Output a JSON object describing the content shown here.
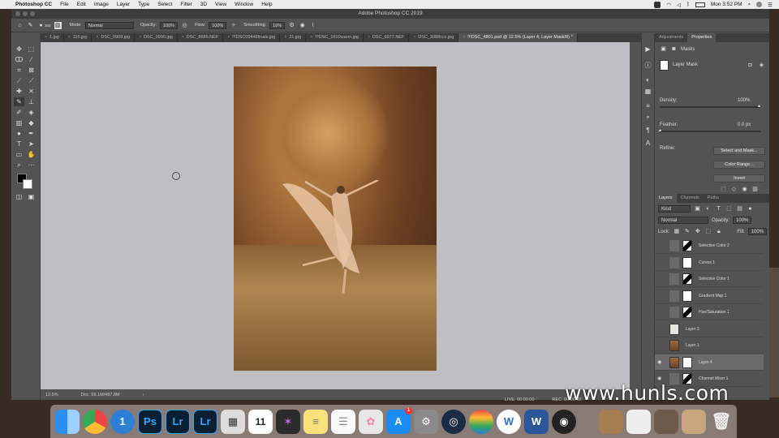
{
  "menubar": {
    "app_name": "Photoshop CC",
    "items": [
      "File",
      "Edit",
      "Image",
      "Layer",
      "Type",
      "Select",
      "Filter",
      "3D",
      "View",
      "Window",
      "Help"
    ],
    "clock": "Mon 3:52 PM"
  },
  "window": {
    "title": "Adobe Photoshop CC 2019"
  },
  "options": {
    "brush_size": "350",
    "mode_label": "Mode:",
    "mode_value": "Normal",
    "opacity_label": "Opacity:",
    "opacity_value": "100%",
    "flow_label": "Flow:",
    "flow_value": "100%",
    "smoothing_label": "Smoothing:",
    "smoothing_value": "10%"
  },
  "tabs": [
    {
      "label": "1.jpg",
      "active": false
    },
    {
      "label": "116.jpg",
      "active": false
    },
    {
      "label": "DSC_0909.jpg",
      "active": false
    },
    {
      "label": "DSC_0990.jpg",
      "active": false
    },
    {
      "label": "DSC_8686.NEF",
      "active": false
    },
    {
      "label": "!!!DSC09448finals.jpg",
      "active": false
    },
    {
      "label": "21.jpg",
      "active": false
    },
    {
      "label": "!!!DSC_1610warm.jpg",
      "active": false
    },
    {
      "label": "DSC_6977.NEF",
      "active": false
    },
    {
      "label": "DSC_3088ccc.jpg",
      "active": false
    },
    {
      "label": "!!!DSC_4801.psd @ 12.5% (Layer 4, Layer Mask/8) *",
      "active": true
    }
  ],
  "status": {
    "zoom": "12.5%",
    "doc": "Doc: 69.1M/487.8M"
  },
  "properties": {
    "tab_adjustments": "Adjustments",
    "tab_properties": "Properties",
    "section": "Masks",
    "mask_label": "Layer Mask",
    "density_label": "Density:",
    "density_value": "100%",
    "feather_label": "Feather:",
    "feather_value": "0.0 px",
    "refine_label": "Refine:",
    "btn_select_mask": "Select and Mask...",
    "btn_color_range": "Color Range...",
    "btn_invert": "Invert"
  },
  "layers_panel": {
    "tab_layers": "Layers",
    "tab_channels": "Channels",
    "tab_paths": "Paths",
    "kind_label": "Kind",
    "blend_value": "Normal",
    "opacity_label": "Opacity:",
    "opacity_value": "100%",
    "lock_label": "Lock:",
    "fill_label": "Fill:",
    "fill_value": "100%",
    "layers": [
      {
        "name": "Selective Color 2",
        "visible": false,
        "selected": false,
        "kind": "adjust-mask"
      },
      {
        "name": "Curves 1",
        "visible": false,
        "selected": false,
        "kind": "adjust-white"
      },
      {
        "name": "Selective Color 1",
        "visible": false,
        "selected": false,
        "kind": "adjust-mask"
      },
      {
        "name": "Gradient Map 1",
        "visible": false,
        "selected": false,
        "kind": "adjust-white"
      },
      {
        "name": "Hue/Saturation 1",
        "visible": false,
        "selected": false,
        "kind": "adjust-mask"
      },
      {
        "name": "Layer 3",
        "visible": false,
        "selected": false,
        "kind": "pixel-light"
      },
      {
        "name": "Layer 1",
        "visible": false,
        "selected": false,
        "kind": "pixel-photo"
      },
      {
        "name": "Layer 4",
        "visible": true,
        "selected": true,
        "kind": "pixel-mask"
      },
      {
        "name": "Channel Mixer 1",
        "visible": true,
        "selected": false,
        "kind": "adjust-mask"
      }
    ]
  },
  "footer_strip": {
    "live": "LIVE: 00:00:00",
    "rec": "REC: 00:00:00"
  },
  "watermark": "www.hunls.com",
  "colors": {
    "ps_blue": "#31a8ff",
    "lr_blue": "#31a8ff",
    "accent": "#2e6dd0"
  },
  "dock_icons": [
    "finder-icon",
    "chrome-icon",
    "1password-icon",
    "photoshop-icon",
    "lightroom-icon",
    "lightroom-classic-icon",
    "preview-icon",
    "calendar-icon",
    "final-cut-icon",
    "notes-icon",
    "reminders-icon",
    "photos-icon",
    "app-store-icon",
    "system-prefs-icon",
    "quicktime-icon",
    "screenflow-icon",
    "wunderlist-icon",
    "word-icon",
    "obs-icon"
  ],
  "dock_labels": {
    "ps": "Ps",
    "lr": "Lr",
    "lrc": "Lr",
    "calendar_day": "11",
    "one": "1",
    "word": "W",
    "app_store_badge": "1"
  }
}
